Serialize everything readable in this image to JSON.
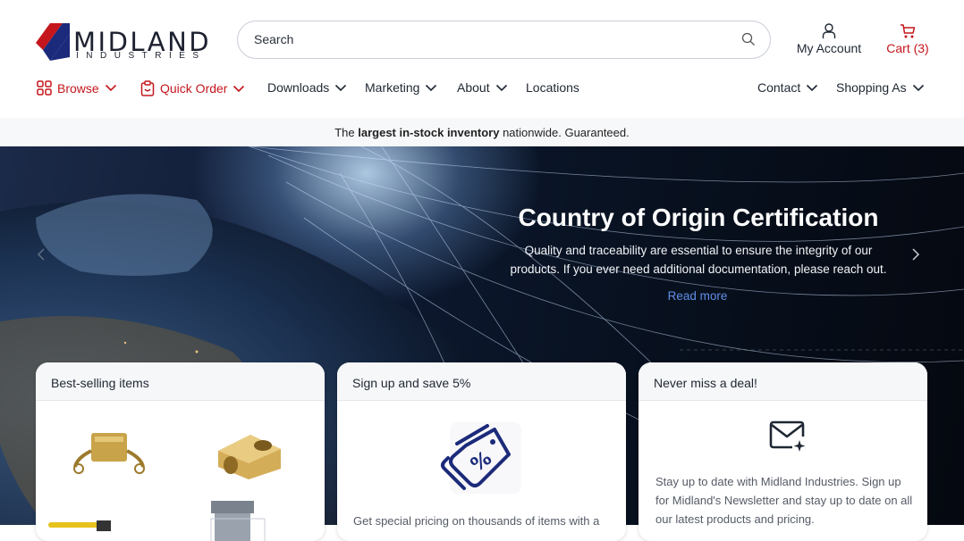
{
  "logo": {
    "word": "MIDLAND",
    "sub": "INDUSTRIES"
  },
  "search": {
    "placeholder": "Search"
  },
  "account": {
    "label": "My Account"
  },
  "cart": {
    "label": "Cart (3)"
  },
  "nav": {
    "browse": "Browse",
    "quick_order": "Quick Order",
    "downloads": "Downloads",
    "marketing": "Marketing",
    "about": "About",
    "locations": "Locations",
    "contact": "Contact",
    "shopping_as": "Shopping As"
  },
  "banner": {
    "pre": "The ",
    "bold": "largest in-stock inventory",
    "post": " nationwide. Guaranteed."
  },
  "hero": {
    "title": "Country of Origin Certification",
    "text": "Quality and traceability are essential to ensure the integrity of our products. If you ever need additional documentation, please reach out.",
    "link": "Read more"
  },
  "cards": {
    "best": {
      "title": "Best-selling items"
    },
    "signup": {
      "title": "Sign up and save 5%",
      "text": "Get special pricing on thousands of items with a"
    },
    "deal": {
      "title": "Never miss a deal!",
      "text": "Stay up to date with Midland Industries. Sign up for Midland's Newsletter and stay up to date on all our latest products and pricing."
    }
  },
  "colors": {
    "brand_red": "#c4161c",
    "brand_navy": "#1b2a7a",
    "link_blue": "#5f8fe6"
  }
}
